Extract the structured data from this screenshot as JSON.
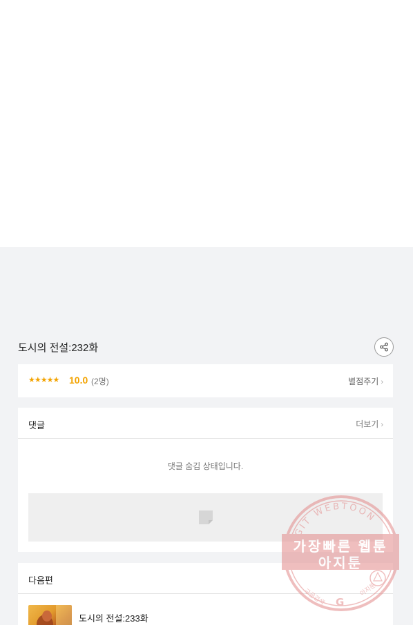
{
  "episode": {
    "title": "도시의 전설:232화"
  },
  "rating": {
    "stars": "★★★★★",
    "score": "10.0",
    "count": "(2명)",
    "rate_button": "별점주기"
  },
  "comments": {
    "title": "댓글",
    "more": "더보기",
    "hidden_message": "댓글 숨김 상태입니다."
  },
  "next": {
    "title": "다음편",
    "item_title": "도시의 전설:233화"
  },
  "watermark": {
    "arc_text": "AGIT WEBTOON",
    "line1": "가장빠른 웹툰",
    "line2": "아지툰",
    "bottom_left": "구글검색",
    "bottom_right": "아지툰"
  },
  "colors": {
    "accent": "#f3a300",
    "watermark": "#e38a8a"
  }
}
